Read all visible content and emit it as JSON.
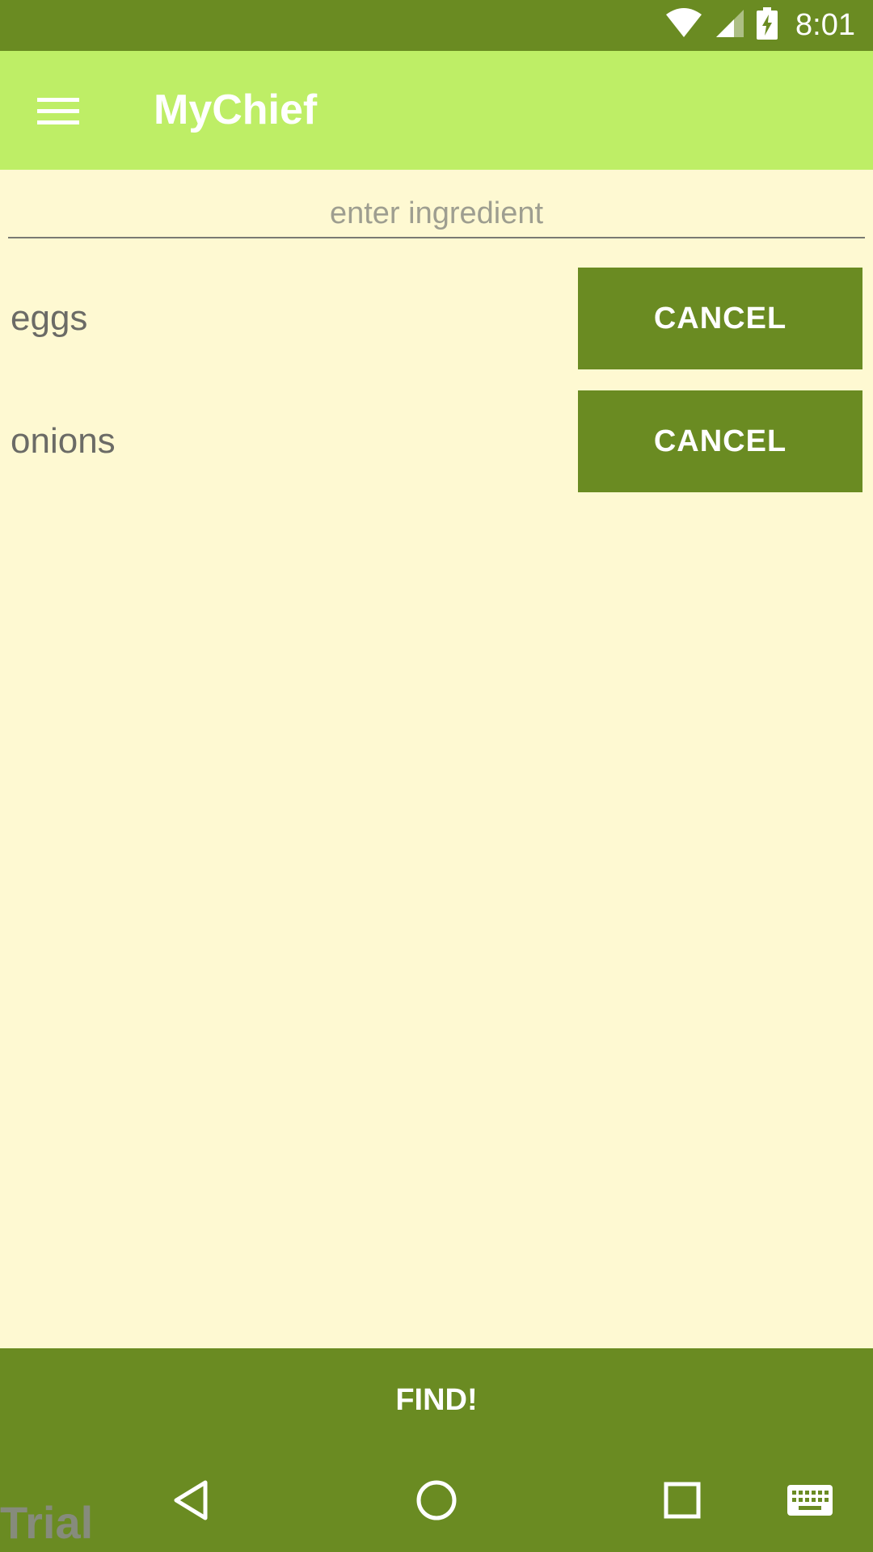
{
  "status_bar": {
    "time": "8:01",
    "icons": [
      "wifi-icon",
      "cellular-signal-icon",
      "battery-charging-icon"
    ]
  },
  "app_bar": {
    "title": "MyChief",
    "menu_icon": "hamburger-menu-icon"
  },
  "ingredient_input": {
    "placeholder": "enter ingredient",
    "value": ""
  },
  "ingredients": [
    {
      "name": "eggs",
      "cancel_label": "CANCEL"
    },
    {
      "name": "onions",
      "cancel_label": "CANCEL"
    }
  ],
  "find_button": {
    "label": "FIND!"
  },
  "nav_bar": {
    "icons": [
      "back-icon",
      "home-icon",
      "recents-icon",
      "keyboard-icon"
    ]
  },
  "watermark": {
    "text": "Trial"
  },
  "colors": {
    "primary_dark": "#6A8B22",
    "primary_light": "#BEEE66",
    "background": "#FEF9D2",
    "text_gray": "#6B6B66"
  }
}
